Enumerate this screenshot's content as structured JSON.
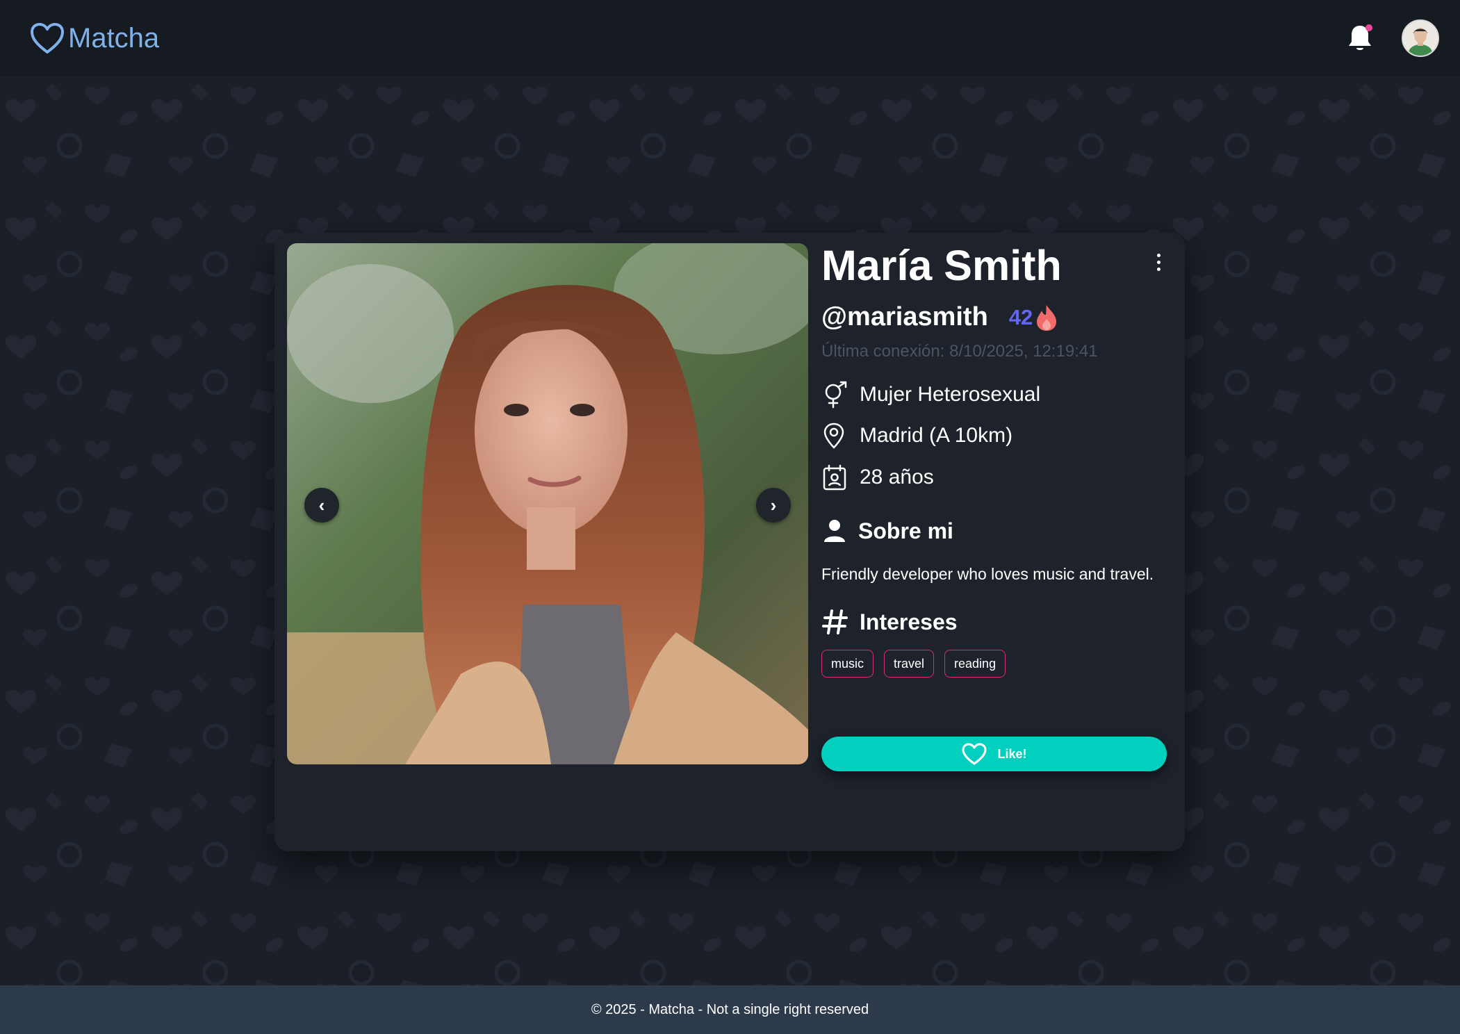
{
  "header": {
    "logo_text": "Matcha",
    "notification_dot_color": "#ec4899"
  },
  "profile": {
    "name": "María Smith",
    "username": "@mariasmith",
    "fame_rating": "42",
    "last_seen": "Última conexión: 8/10/2025, 12:19:41",
    "gender_orientation": "Mujer Heterosexual",
    "location": "Madrid (A 10km)",
    "age": "28 años",
    "about_title": "Sobre mi",
    "bio": "Friendly developer who loves music and travel.",
    "interests_title": "Intereses",
    "interests": [
      "music",
      "travel",
      "reading"
    ],
    "like_label": "Like!"
  },
  "gallery": {
    "prev_glyph": "‹",
    "next_glyph": "›"
  },
  "footer": {
    "text": "© 2025 - Matcha - Not a single right reserved"
  },
  "colors": {
    "accent_teal": "#00d0bd",
    "fame_indigo": "#6366f1",
    "tag_border_pink": "#db2777",
    "logo_blue": "#7fb2ea"
  }
}
